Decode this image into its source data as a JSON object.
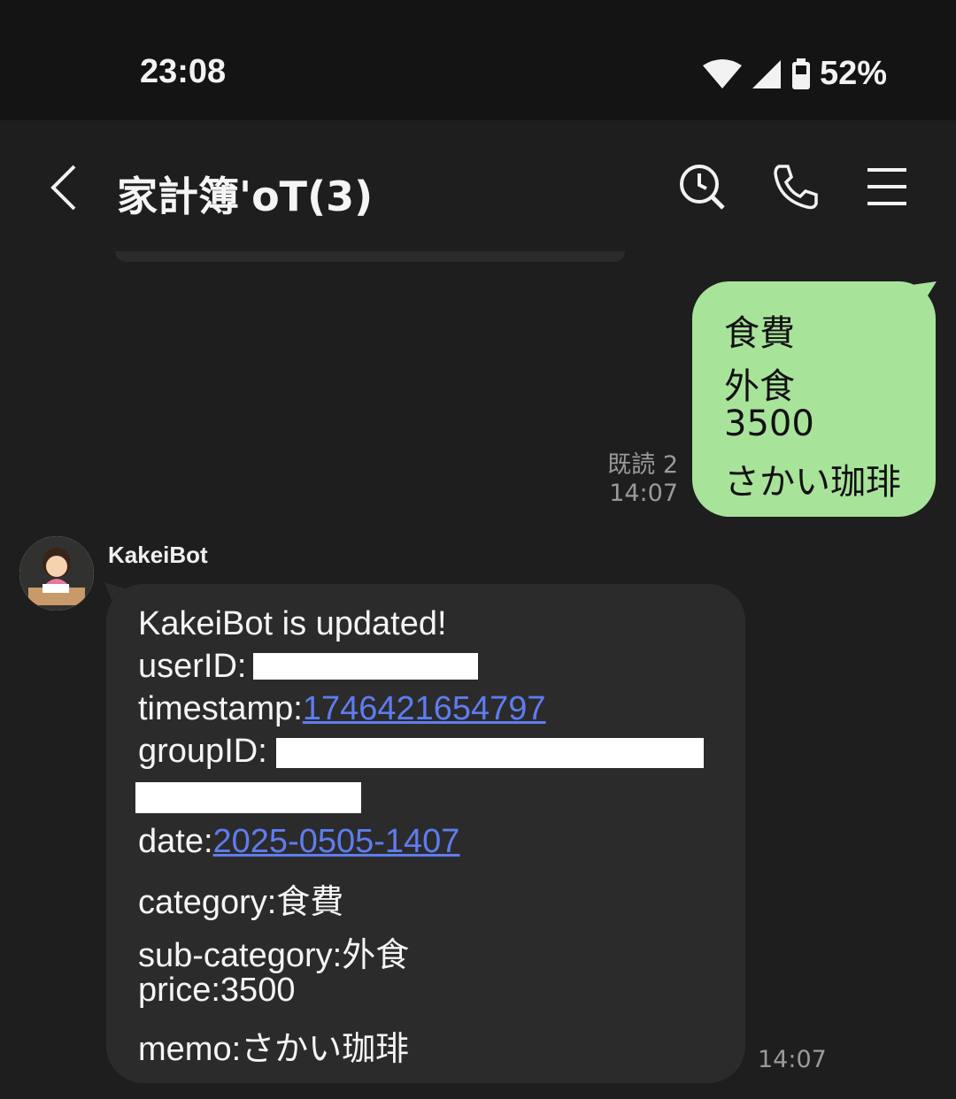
{
  "status_bar": {
    "time": "23:08",
    "battery": "52%"
  },
  "header": {
    "title": "家計簿'oT(3)"
  },
  "outgoing_message": {
    "lines": [
      "食費",
      "外食",
      "3500",
      "さかい珈琲"
    ],
    "read_label": "既読 2",
    "time": "14:07"
  },
  "incoming_message": {
    "sender": "KakeiBot",
    "line1": "KakeiBot is updated!",
    "userid_label": "userID:",
    "timestamp_label": "timestamp:",
    "timestamp_value": "1746421654797",
    "groupid_label": "groupID:",
    "date_label": "date:",
    "date_value": "2025-0505-1407",
    "category": "category:食費",
    "sub_category": "sub-category:外食",
    "price": "price:3500",
    "memo": "memo:さかい珈琲",
    "time": "14:07"
  },
  "colors": {
    "outgoing_bubble": "#a8e39a",
    "incoming_bubble": "#2b2b2b",
    "link": "#5f7cf0"
  }
}
